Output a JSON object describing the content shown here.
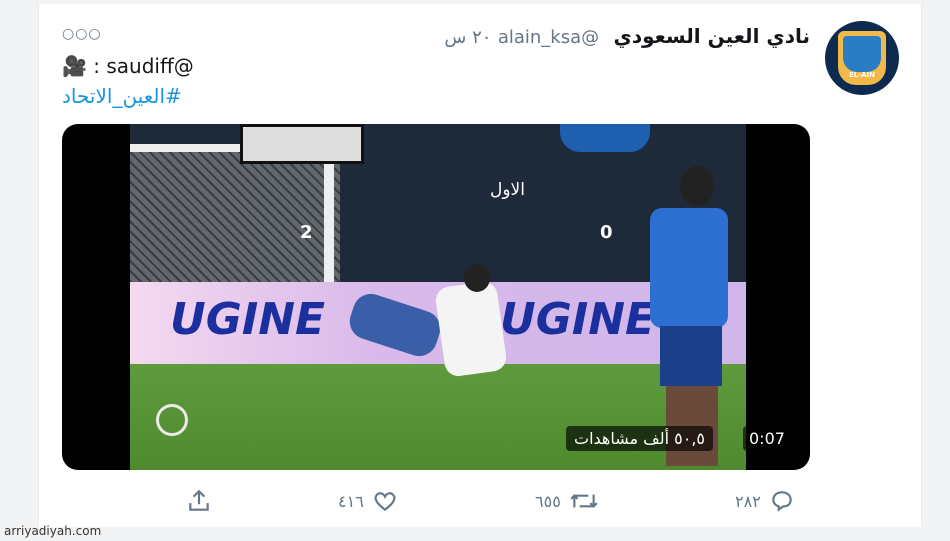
{
  "tweet": {
    "account_name": "نادي العين السعودي",
    "handle": "@alain_ksa",
    "time": "٢٠ س",
    "line1": "🎥 : saudiff@",
    "hashtag": "#العين_الاتحاد"
  },
  "video": {
    "duration": "0:07",
    "views": "٥٠,٥ ألف مشاهدات",
    "scoreboard": {
      "left_score": "2",
      "right_score": "0",
      "period": "الاول"
    },
    "ad_text_1": "UGINE",
    "ad_text_2": "UGINE"
  },
  "actions": {
    "reply_count": "٢٨٢",
    "retweet_count": "٦٥٥",
    "like_count": "٤١٦"
  },
  "footer": {
    "site": "arriyadiyah.com"
  },
  "colors": {
    "link": "#1b95e0",
    "muted": "#657786",
    "avatar_bg": "#0f2a4f"
  }
}
